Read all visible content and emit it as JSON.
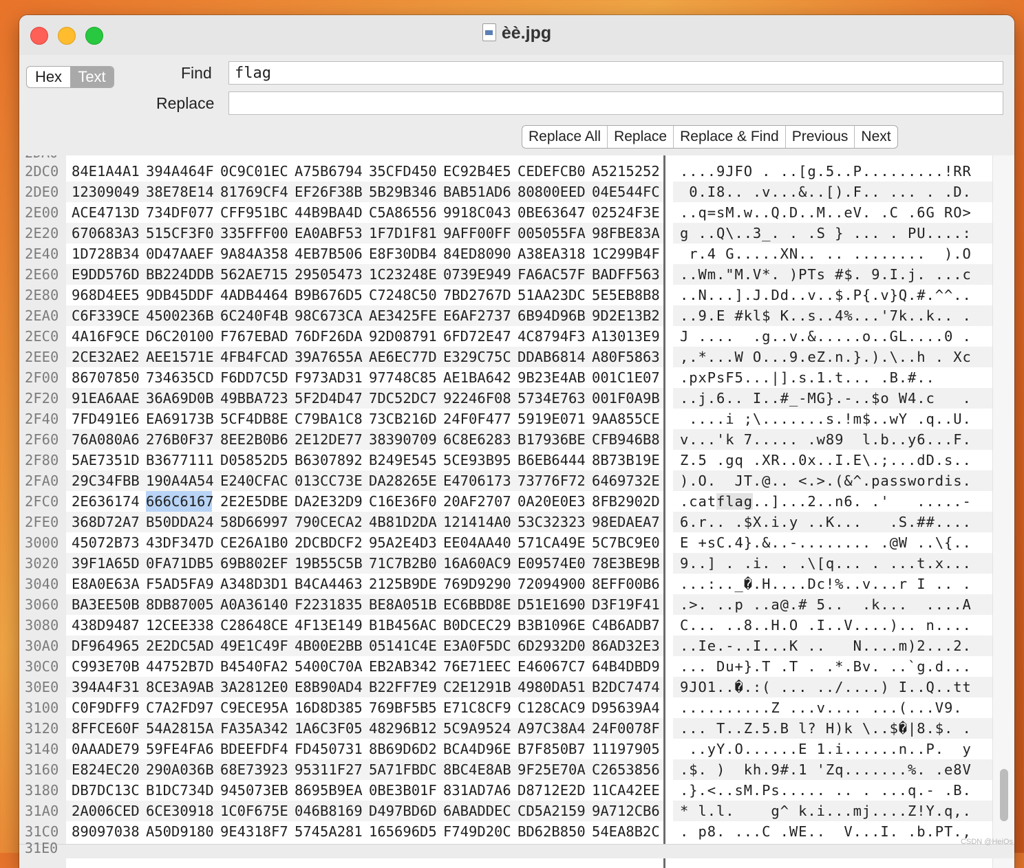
{
  "window": {
    "title": "èè.jpg",
    "file_icon": "jpeg-file-icon"
  },
  "toolbar": {
    "mode_hex": "Hex",
    "mode_text": "Text",
    "active_mode": "Text",
    "find_label": "Find",
    "find_value": "flag",
    "replace_label": "Replace",
    "replace_value": "",
    "buttons": [
      "Replace All",
      "Replace",
      "Replace & Find",
      "Previous",
      "Next"
    ]
  },
  "offset_top_partial": "2DA0",
  "offset_bottom_partial": "31E0",
  "rows": [
    {
      "off": "2DC0",
      "hex": [
        "84E1A4A1",
        "394A464F",
        "0C9C01EC",
        "A75B6794",
        "35CFD450",
        "EC92B4E5",
        "CEDEFCB0",
        "A5215252"
      ],
      "text": "....9JFO . ..[g.5..P.........!RR"
    },
    {
      "off": "2DE0",
      "hex": [
        "12309049",
        "38E78E14",
        "81769CF4",
        "EF26F38B",
        "5B29B346",
        "BAB51AD6",
        "80800EED",
        "04E544FC"
      ],
      "text": " 0.I8.. .v...&..[).F.. ... . .D."
    },
    {
      "off": "2E00",
      "hex": [
        "ACE4713D",
        "734DF077",
        "CFF951BC",
        "44B9BA4D",
        "C5A86556",
        "9918C043",
        "0BE63647",
        "02524F3E"
      ],
      "text": "..q=sM.w..Q.D..M..eV. .C .6G RO>"
    },
    {
      "off": "2E20",
      "hex": [
        "670683A3",
        "515CF3F0",
        "335FFF00",
        "EA0ABF53",
        "1F7D1F81",
        "9AFF00FF",
        "005055FA",
        "98FBE83A"
      ],
      "text": "g ..Q\\..3_. . .S } ... . PU....:"
    },
    {
      "off": "2E40",
      "hex": [
        "1D728B34",
        "0D47AAEF",
        "9A84A358",
        "4EB7B506",
        "E8F30DB4",
        "84ED8090",
        "A38EA318",
        "1C299B4F"
      ],
      "text": " r.4 G.....XN.. .. ........  ).O"
    },
    {
      "off": "2E60",
      "hex": [
        "E9DD576D",
        "BB224DDB",
        "562AE715",
        "29505473",
        "1C23248E",
        "0739E949",
        "FA6AC57F",
        "BADFF563"
      ],
      "text": "..Wm.\"M.V*. )PTs #$. 9.I.j. ...c"
    },
    {
      "off": "2E80",
      "hex": [
        "968D4EE5",
        "9DB45DDF",
        "4ADB4464",
        "B9B676D5",
        "C7248C50",
        "7BD2767D",
        "51AA23DC",
        "5E5EB8B8"
      ],
      "text": "..N...].J.Dd..v..$.P{.v}Q.#.^^.."
    },
    {
      "off": "2EA0",
      "hex": [
        "C6F339CE",
        "4500236B",
        "6C240F4B",
        "98C673CA",
        "AE3425FE",
        "E6AF2737",
        "6B94D96B",
        "9D2E13B2"
      ],
      "text": "..9.E #kl$ K..s..4%...'7k..k.. ."
    },
    {
      "off": "2EC0",
      "hex": [
        "4A16F9CE",
        "D6C20100",
        "F767EBAD",
        "76DF26DA",
        "92D08791",
        "6FD72E47",
        "4C8794F3",
        "A13013E9"
      ],
      "text": "J ....  .g..v.&.....o..GL....0 ."
    },
    {
      "off": "2EE0",
      "hex": [
        "2CE32AE2",
        "AEE1571E",
        "4FB4FCAD",
        "39A7655A",
        "AE6EC77D",
        "E329C75C",
        "DDAB6814",
        "A80F5863"
      ],
      "text": ",.*...W O...9.eZ.n.}.).\\..h . Xc"
    },
    {
      "off": "2F00",
      "hex": [
        "86707850",
        "734635CD",
        "F6DD7C5D",
        "F973AD31",
        "97748C85",
        "AE1BA642",
        "9B23E4AB",
        "001C1E07"
      ],
      "text": ".pxPsF5...|].s.1.t... .B.#.."
    },
    {
      "off": "2F20",
      "hex": [
        "91EA6AAE",
        "36A69D0B",
        "49BBA723",
        "5F2D4D47",
        "7DC52DC7",
        "92246F08",
        "5734E763",
        "001F0A9B"
      ],
      "text": "..j.6.. I..#_-MG}.-..$o W4.c   ."
    },
    {
      "off": "2F40",
      "hex": [
        "7FD491E6",
        "EA69173B",
        "5CF4DB8E",
        "C79BA1C8",
        "73CB216D",
        "24F0F477",
        "5919E071",
        "9AA855CE"
      ],
      "text": " ....i ;\\.......s.!m$..wY .q..U."
    },
    {
      "off": "2F60",
      "hex": [
        "76A080A6",
        "276B0F37",
        "8EE2B0B6",
        "2E12DE77",
        "38390709",
        "6C8E6283",
        "B17936BE",
        "CFB946B8"
      ],
      "text": "v...'k 7..... .w89  l.b..y6...F."
    },
    {
      "off": "2F80",
      "hex": [
        "5AE7351D",
        "B3677111",
        "D05852D5",
        "B6307892",
        "B249E545",
        "5CE93B95",
        "B6EB6444",
        "8B73B19E"
      ],
      "text": "Z.5 .gq .XR..0x..I.E\\.;...dD.s.."
    },
    {
      "off": "2FA0",
      "hex": [
        "29C34FBB",
        "190A4A54",
        "E240CFAC",
        "013CC73E",
        "DA28265E",
        "E4706173",
        "73776F72",
        "6469732E"
      ],
      "text": ").O.  JT.@.. <.>.(&^.passwordis."
    },
    {
      "off": "2FC0",
      "hex": [
        "2E636174",
        "666C6167",
        "2E2E5DBE",
        "DA2E32D9",
        "C16E36F0",
        "20AF2707",
        "0A20E0E3",
        "8FB2902D"
      ],
      "text": ".catflag..]...2..n6. .'   .....-",
      "hl": true
    },
    {
      "off": "2FE0",
      "hex": [
        "368D72A7",
        "B50DDA24",
        "58D66997",
        "790CECA2",
        "4B81D2DA",
        "121414A0",
        "53C32323",
        "98EDAEA7"
      ],
      "text": "6.r.. .$X.i.y ..K...   .S.##...."
    },
    {
      "off": "3000",
      "hex": [
        "45072B73",
        "43DF347D",
        "CE26A1B0",
        "2DCBDCF2",
        "95A2E4D3",
        "EE04AA40",
        "571CA49E",
        "5C7BC9E0"
      ],
      "text": "E +sC.4}.&..-........ .@W ..\\{.."
    },
    {
      "off": "3020",
      "hex": [
        "39F1A65D",
        "0FA71DB5",
        "69B802EF",
        "19B55C5B",
        "71C7B2B0",
        "16A60AC9",
        "E09574E0",
        "78E3BE9B"
      ],
      "text": "9..] . .i. . .\\[q... . ...t.x..."
    },
    {
      "off": "3040",
      "hex": [
        "E8A0E63A",
        "F5AD5FA9",
        "A348D3D1",
        "B4CA4463",
        "2125B9DE",
        "769D9290",
        "72094900",
        "8EFF00B6"
      ],
      "text": "...:.._�.H....Dc!%..v...r I .. ."
    },
    {
      "off": "3060",
      "hex": [
        "BA3EE50B",
        "8DB87005",
        "A0A36140",
        "F2231835",
        "BE8A051B",
        "EC6BBD8E",
        "D51E1690",
        "D3F19F41"
      ],
      "text": ".>. ..p ..a@.# 5..  .k...  ....A"
    },
    {
      "off": "3080",
      "hex": [
        "438D9487",
        "12CEE338",
        "C28648CE",
        "4F13E149",
        "B1B456AC",
        "B0DCEC29",
        "B3B1096E",
        "C4B6ADB7"
      ],
      "text": "C... ..8..H.O .I..V....).. n...."
    },
    {
      "off": "30A0",
      "hex": [
        "DF964965",
        "2E2DC5AD",
        "49E1C49F",
        "4B00E2BB",
        "05141C4E",
        "E3A0F5DC",
        "6D2932D0",
        "86AD32E3"
      ],
      "text": "..Ie.-..I...K ..   N....m)2...2."
    },
    {
      "off": "30C0",
      "hex": [
        "C993E70B",
        "44752B7D",
        "B4540FA2",
        "5400C70A",
        "EB2AB342",
        "76E71EEC",
        "E46067C7",
        "64B4DBD9"
      ],
      "text": "... Du+}.T .T . .*.Bv. ..`g.d..."
    },
    {
      "off": "30E0",
      "hex": [
        "394A4F31",
        "8CE3A9AB",
        "3A2812E0",
        "E8B90AD4",
        "B22FF7E9",
        "C2E1291B",
        "4980DA51",
        "B2DC7474"
      ],
      "text": "9JO1..�.:( ... ../....) I..Q..tt"
    },
    {
      "off": "3100",
      "hex": [
        "C0F9DFF9",
        "C7A2FD97",
        "C9ECE95A",
        "16D8D385",
        "769BF5B5",
        "E71C8CF9",
        "C128CAC9",
        "D95639A4"
      ],
      "text": "..........Z ...v.... ...(...V9."
    },
    {
      "off": "3120",
      "hex": [
        "8FFCE60F",
        "54A2815A",
        "FA35A342",
        "1A6C3F05",
        "48296B12",
        "5C9A9524",
        "A97C38A4",
        "24F0078F"
      ],
      "text": "... T..Z.5.B l? H)k \\..$�|8.$. ."
    },
    {
      "off": "3140",
      "hex": [
        "0AAADE79",
        "59FE4FA6",
        "BDEEFDF4",
        "FD450731",
        "8B69D6D2",
        "BCA4D96E",
        "B7F850B7",
        "11197905"
      ],
      "text": " ..yY.O......E 1.i......n..P.  y"
    },
    {
      "off": "3160",
      "hex": [
        "E824EC20",
        "290A036B",
        "68E73923",
        "95311F27",
        "5A71FBDC",
        "8BC4E8AB",
        "9F25E70A",
        "C2653856"
      ],
      "text": ".$. )  kh.9#.1 'Zq.......%. .e8V"
    },
    {
      "off": "3180",
      "hex": [
        "DB7DC13C",
        "B1DC734D",
        "945073EB",
        "8695B9EA",
        "0BE3B01F",
        "831AD7A6",
        "D8712E2D",
        "11CA42EE"
      ],
      "text": ".}.<..sM.Ps..... .. . ...q.- .B."
    },
    {
      "off": "31A0",
      "hex": [
        "2A006CED",
        "6CE30918",
        "1C0F675E",
        "046B8169",
        "D497BD6D",
        "6ABADDEC",
        "CD5A2159",
        "9A712CB6"
      ],
      "text": "* l.l.    g^ k.i...mj....Z!Y.q,."
    },
    {
      "off": "31C0",
      "hex": [
        "89097038",
        "A50D9180",
        "9E4318F7",
        "5745A281",
        "165696D5",
        "F749D20C",
        "BD62B850",
        "54EA8B2C"
      ],
      "text": ". p8. ...C .WE..  V...I. .b.PT.,"
    }
  ],
  "watermark": "CSDN @HeiOs"
}
